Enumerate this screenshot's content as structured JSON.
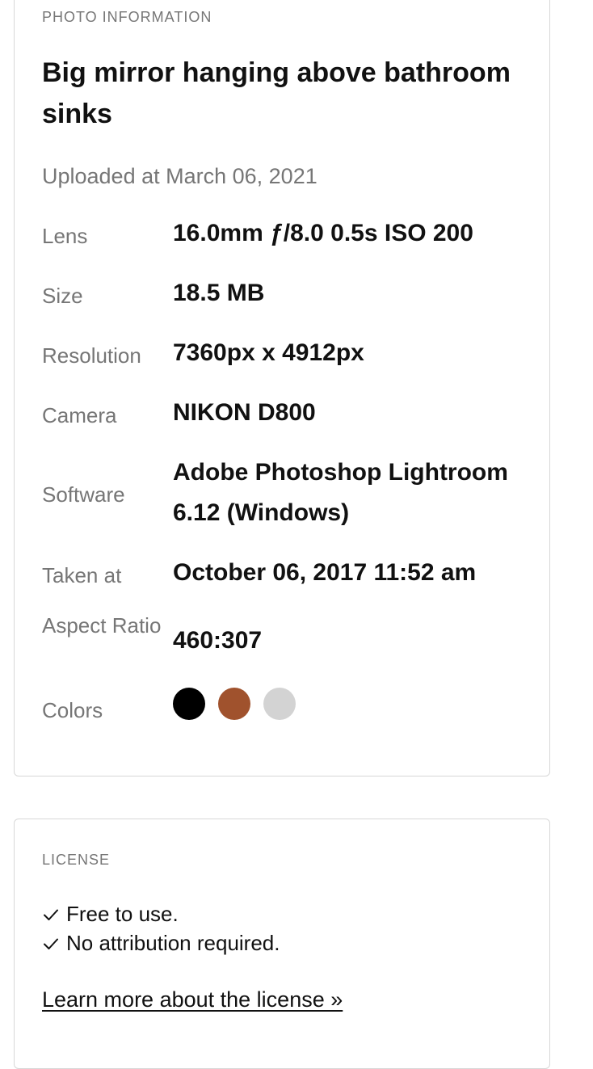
{
  "photo_info": {
    "section_label": "PHOTO INFORMATION",
    "title": "Big mirror hanging above bathroom sinks",
    "uploaded": "Uploaded at March 06, 2021",
    "rows": [
      {
        "label": "Lens",
        "value": "16.0mm ƒ/8.0 0.5s ISO 200"
      },
      {
        "label": "Size",
        "value": "18.5 MB"
      },
      {
        "label": "Resolution",
        "value": "7360px x 4912px"
      },
      {
        "label": "Camera",
        "value": "NIKON D800"
      },
      {
        "label": "Software",
        "value": "Adobe Photoshop Lightroom 6.12 (Windows)"
      },
      {
        "label": "Taken at",
        "value": "October 06, 2017 11:52 am"
      },
      {
        "label": "Aspect Ratio",
        "value": "460:307"
      }
    ],
    "colors_label": "Colors",
    "colors": [
      "#000000",
      "#a0522d",
      "#d3d3d3"
    ]
  },
  "license": {
    "section_label": "LICENSE",
    "items": [
      "Free to use.",
      "No attribution required."
    ],
    "link_text": "Learn more about the license »"
  }
}
